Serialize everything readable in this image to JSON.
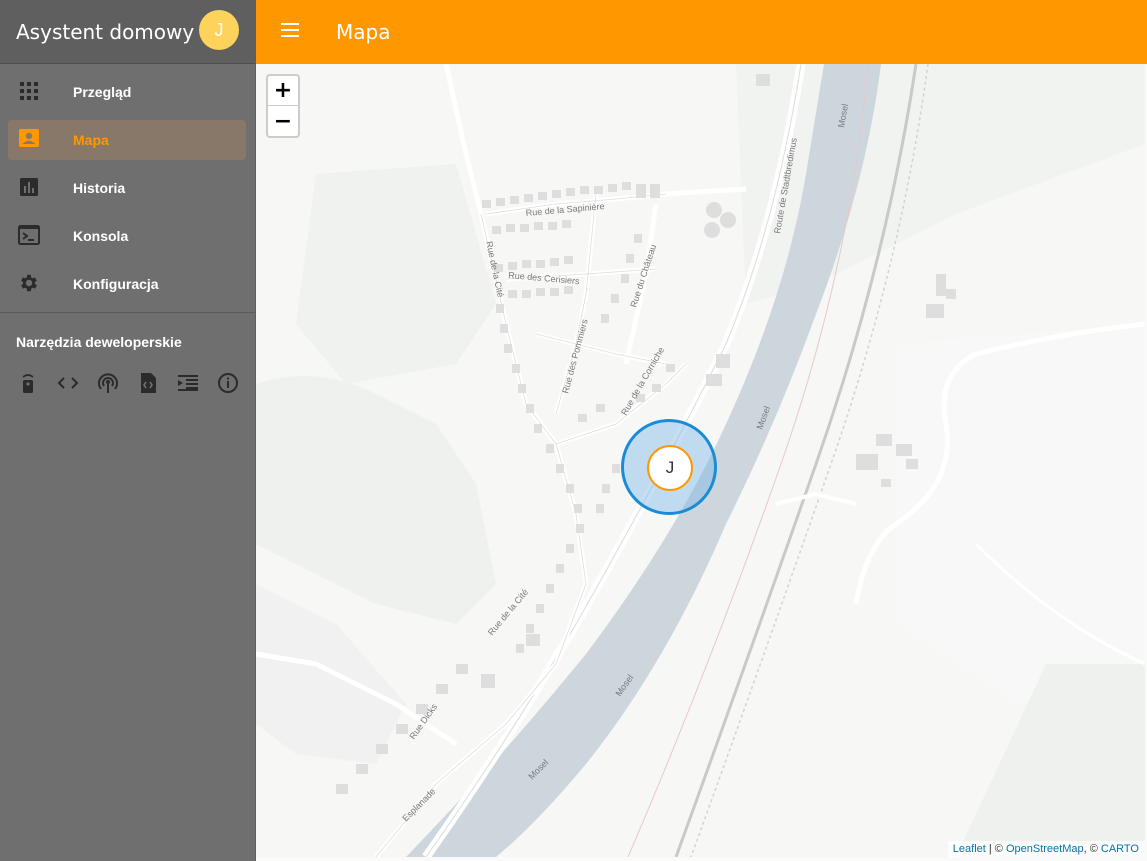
{
  "app": {
    "title": "Asystent domowy",
    "avatar_initial": "J"
  },
  "sidebar": {
    "items": [
      {
        "label": "Przegląd",
        "icon": "grid-icon",
        "active": false
      },
      {
        "label": "Mapa",
        "icon": "account-box-icon",
        "active": true
      },
      {
        "label": "Historia",
        "icon": "bar-chart-icon",
        "active": false
      },
      {
        "label": "Konsola",
        "icon": "console-icon",
        "active": false
      },
      {
        "label": "Konfiguracja",
        "icon": "gear-icon",
        "active": false
      }
    ],
    "dev_title": "Narzędzia deweloperskie",
    "dev_tools": [
      "remote-icon",
      "code-icon",
      "broadcast-icon",
      "file-code-icon",
      "template-icon",
      "info-icon"
    ]
  },
  "header": {
    "title": "Mapa"
  },
  "map": {
    "zoom_in": "+",
    "zoom_out": "−",
    "marker_label": "J",
    "attribution": {
      "leaflet": "Leaflet",
      "sep1": " | © ",
      "osm": "OpenStreetMap",
      "sep2": ", © ",
      "carto": "CARTO"
    },
    "street_labels": [
      "Rue de la Sapinière",
      "Rue des Cerisiers",
      "Rue du Château",
      "Rue de la Cité",
      "Rue des Pommiers",
      "Rue de la Corniche",
      "Route de Stadtbredimus",
      "Mosel",
      "Esplanade",
      "Rue Dicks"
    ]
  },
  "colors": {
    "accent": "#ff9800",
    "sidebar_bg": "#6f6f6f",
    "zone_border": "#1a8cd6",
    "river": "#cdd6dc"
  }
}
